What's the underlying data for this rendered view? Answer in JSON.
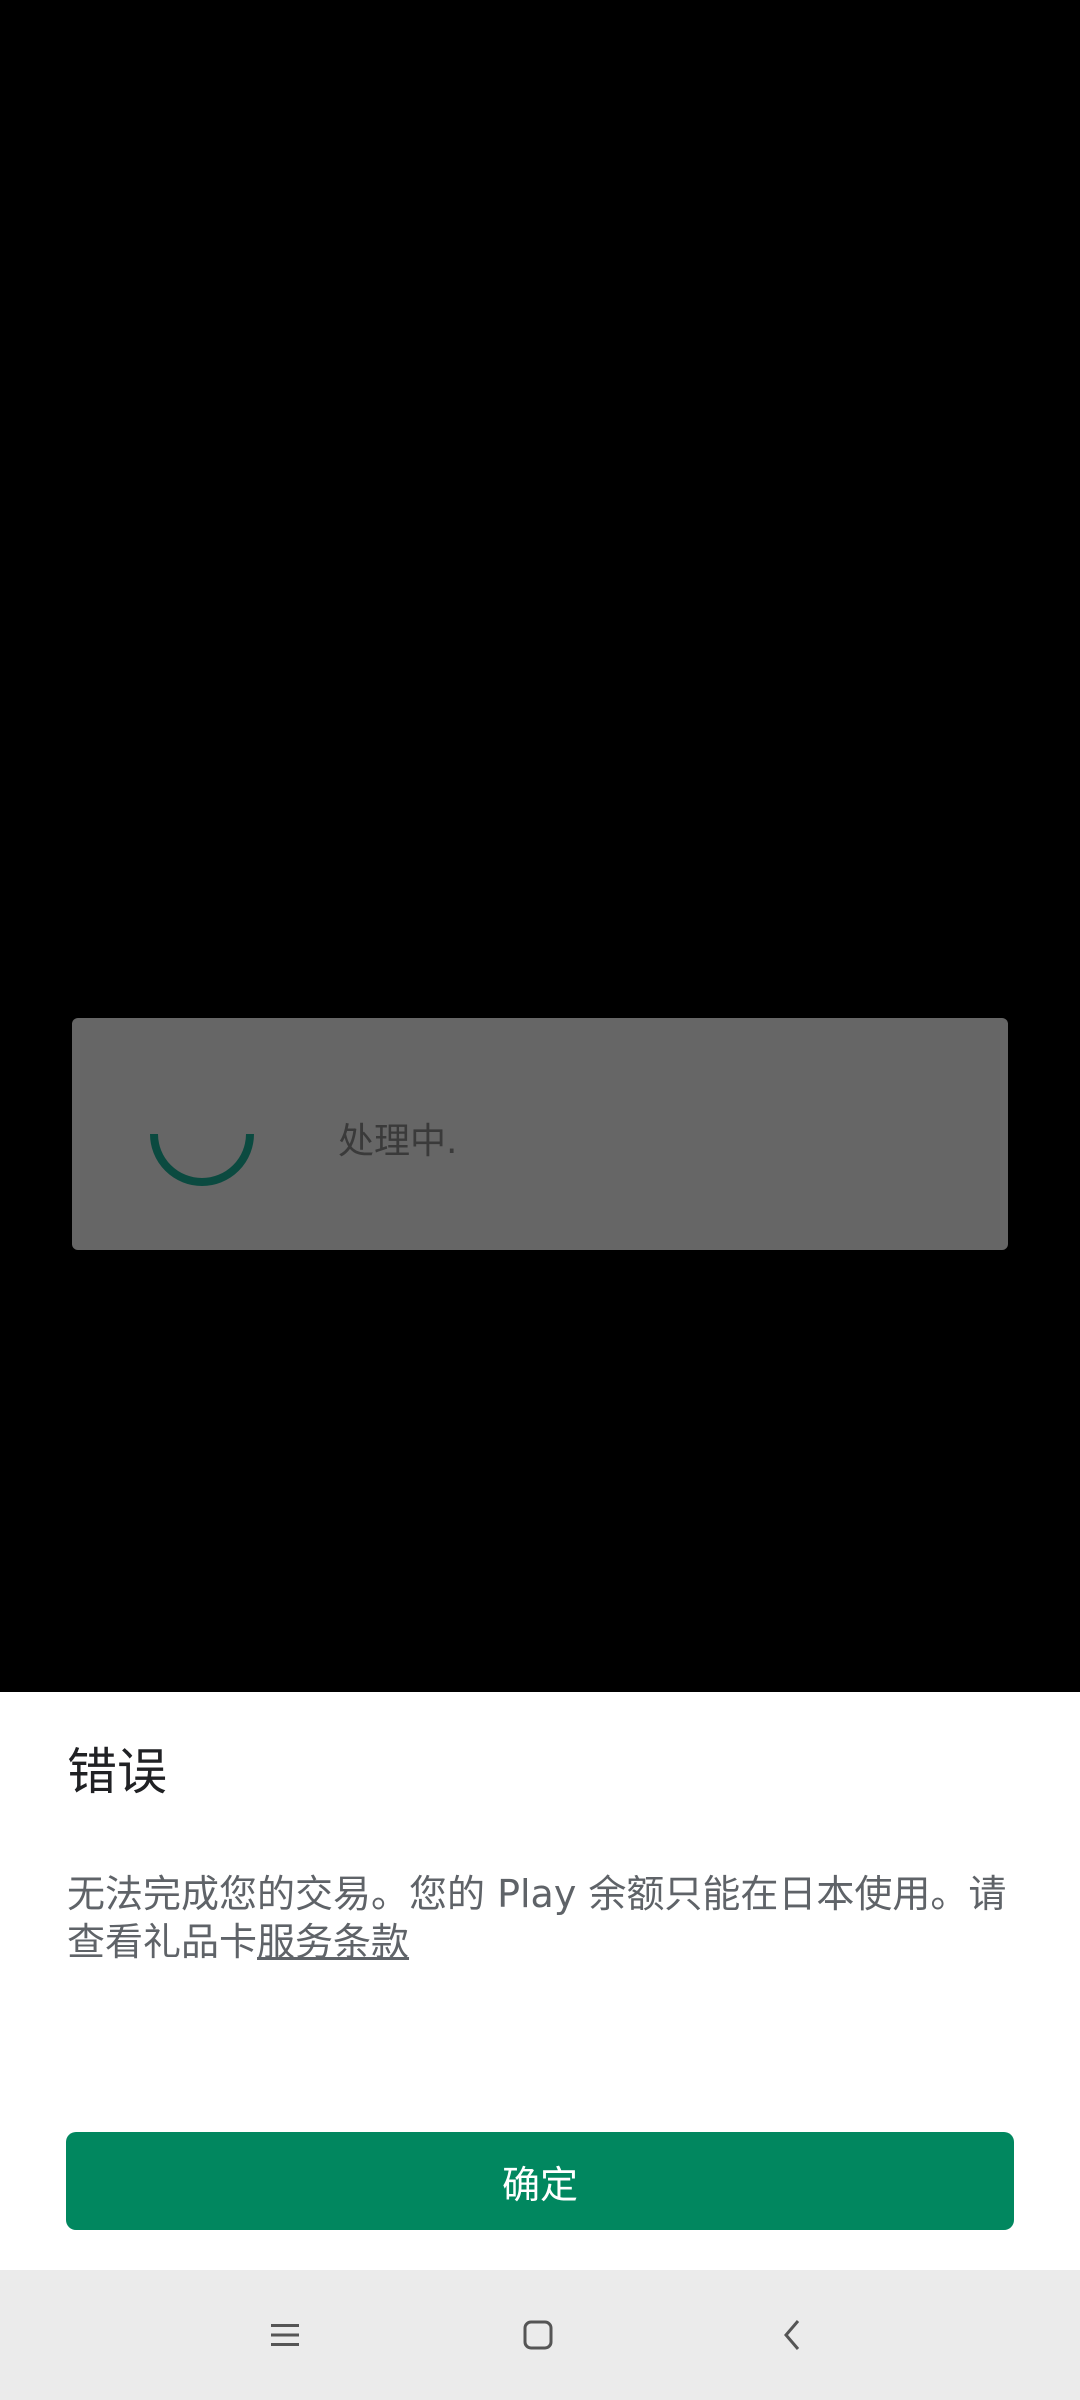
{
  "processing": {
    "text": "处理中."
  },
  "error_sheet": {
    "title": "错误",
    "message": "无法完成您的交易。您的 Play 余额只能在日本使用。请查看礼品卡",
    "link_label": "服务条款",
    "ok_label": "确定",
    "accent_color": "#01875f"
  },
  "navbar": {
    "buttons": [
      "menu-icon",
      "home-icon",
      "back-icon"
    ]
  }
}
